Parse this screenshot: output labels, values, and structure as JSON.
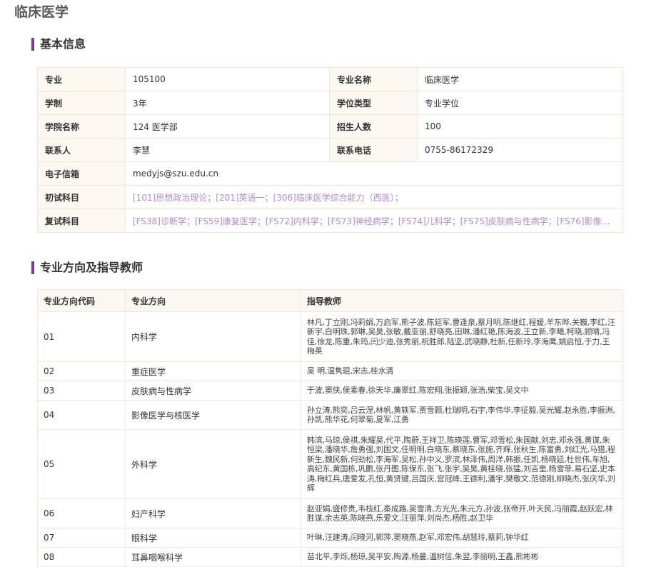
{
  "page": {
    "title": "临床医学"
  },
  "basic_info": {
    "section_title": "基本信息",
    "rows": [
      {
        "l1": "专业",
        "v1": "105100",
        "l2": "专业名称",
        "v2": "临床医学"
      },
      {
        "l1": "学制",
        "v1": "3年",
        "l2": "学位类型",
        "v2": "专业学位"
      },
      {
        "l1": "学院名称",
        "v1": "124 医学部",
        "l2": "招生人数",
        "v2": "100"
      },
      {
        "l1": "联系人",
        "v1": "李慧",
        "l2": "联系电话",
        "v2": "0755-86172329"
      }
    ],
    "email": {
      "label": "电子信箱",
      "value": "medyjs@szu.edu.cn"
    },
    "first_exam": {
      "label": "初试科目",
      "value": "[101]思想政治理论；[201]英语一；[306]临床医学综合能力（西医）；"
    },
    "retest": {
      "label": "复试科目",
      "value": "[FS38]诊断学；[FS59]康复医学；[FS72]内科学；[FS73]神经病学；[FS74]儿科学；[FS75]皮肤病与性病学；[FS76]影像医学..."
    }
  },
  "directions": {
    "section_title": "专业方向及指导教师",
    "headers": [
      "专业方向代码",
      "专业方向",
      "指导教师"
    ],
    "rows": [
      {
        "code": "01",
        "name": "内科学",
        "teachers": "林凡,丁立刚,冯莉娟,万启军,熊子波,陈延军,曹逢泉,蔡月明,陈继红,程媛,羊东晔,关巍,李红,汪新宇,白明珠,郭琳,吴昊,张敏,戴亚丽,舒晓亮,田琳,潘红艳,陈海波,王立新,李曦,柯晓,顾晴,冯佳,徐龙,陈重,朱筠,闫少迪,张秀丽,祝胜郎,陆坚,武晓静,杜新,任新玲,李海鹰,姚启恒,于力,王梅英"
      },
      {
        "code": "02",
        "name": "重症医学",
        "teachers": "吴 明,温隽琨,宋志,桂水清"
      },
      {
        "code": "03",
        "name": "皮肤病与性病学",
        "teachers": "于波,窦侠,侯素春,徐天华,廉翠红,陈宏翔,张振颖,张浩,柴宝,吴文中"
      },
      {
        "code": "04",
        "name": "影像医学与核医学",
        "teachers": "孙立涛,熊奕,吕云涅,林帆,黄轶军,贾雪颢,杜瑞明,石宇,李伟华,李征毅,吴光耀,赵永胜,李振洲,孙凯,熊华花,何翠菊,夏军,江勇"
      },
      {
        "code": "05",
        "name": "外科学",
        "teachers": "韩滨,马琼,侯祺,朱耀昊,代平,陶蔚,王祥卫,陈瑛莲,曹军,邓雪松,朱国献,刘忠,邓永强,黄谋,朱恒梁,潘晓华,詹勇强,刘国文,任明明,白晓东,蔡晓东,张施,齐辉,张秋生,陈富勇,刘红光,马猎,程新生,魏民新,何劲松,李海军,吴松,孙中义,罗滨,林泽伟,周洋,韩振,任凯,杨晓延,杜世伟,车旭,高纪东,黄国栋,巩鹏,张丹图,陈保东,张飞,张宇,吴昊,黄桂晓,张猛,刘吉奎,杨雪菲,易石坚,史本涛,梅红兵,唐爱发,孔恒,黄贤键,吕国庆,宫冠峰,王德利,潘宇,樊敬文,范德刚,柳晓杰,张庆华,刘辉"
      },
      {
        "code": "06",
        "name": "妇产科学",
        "teachers": "赵亚娟,盛修贵,韦枝红,秦成路,吴雪清,方光光,朱元方,孙波,张帝开,叶天民,冯丽霞,赵跃宏,林胜谋,余志英,陈晓燕,乐爱文,汪丽萍,刘尚杰,杨胜,赵卫华"
      },
      {
        "code": "07",
        "name": "眼科学",
        "teachers": "叶琳,汪建涛,闫晓河,郭萍,窦晓燕,赵军,邓宏伟,胡慧玲,蔡莉,钟华红"
      },
      {
        "code": "08",
        "name": "耳鼻咽喉科学",
        "teachers": "苗北平,李烁,杨琼,吴平安,陶源,杨曼,温树信,朱翌,李丽明,王鑫,熊彬彬"
      }
    ]
  }
}
